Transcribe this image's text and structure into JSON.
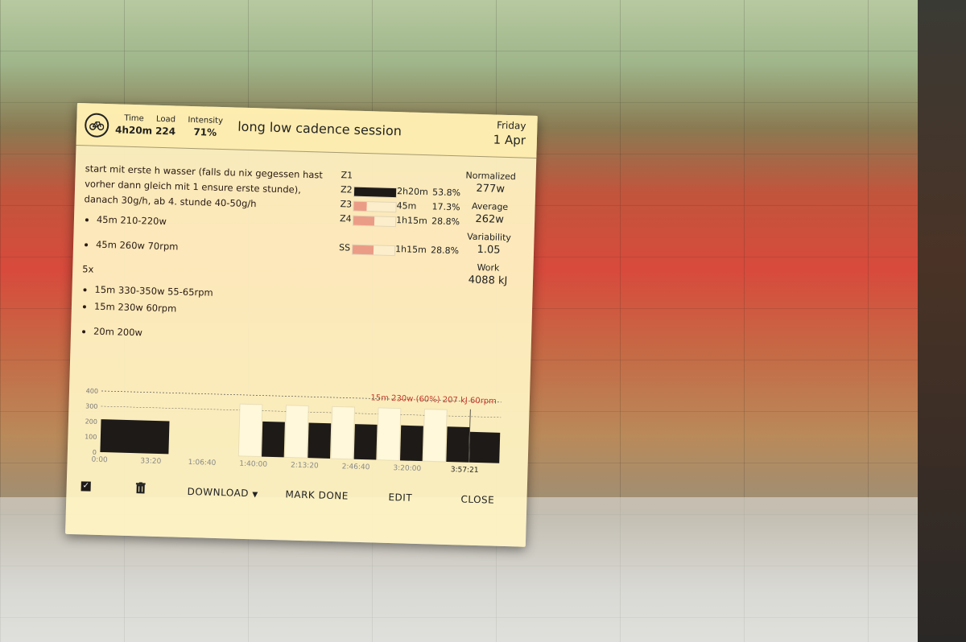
{
  "header": {
    "stats": [
      {
        "label": "Time",
        "value": "4h20m"
      },
      {
        "label": "Load",
        "value": "224"
      },
      {
        "label": "Intensity",
        "value": "71%"
      }
    ],
    "title": "long low cadence session",
    "day": "Friday",
    "date": "1 Apr"
  },
  "description": {
    "intro": "start mit erste h wasser (falls du nix gegessen hast vorher dann gleich mit 1 ensure erste stunde), danach 30g/h, ab 4. stunde 40-50g/h",
    "block1": [
      "45m 210-220w",
      "45m 260w 70rpm"
    ],
    "repeat": "5x",
    "block2": [
      "15m 330-350w 55-65rpm",
      "15m 230w 60rpm"
    ],
    "block3": [
      "20m 200w"
    ]
  },
  "zones": [
    {
      "label": "Z1",
      "time": "",
      "pct": "",
      "fill": 0
    },
    {
      "label": "Z2",
      "time": "2h20m",
      "pct": "53.8%",
      "fill": 1.0
    },
    {
      "label": "Z3",
      "time": "45m",
      "pct": "17.3%",
      "fill": 0.3
    },
    {
      "label": "Z4",
      "time": "1h15m",
      "pct": "28.8%",
      "fill": 0.5
    },
    {
      "label": "",
      "time": "",
      "pct": "",
      "fill": 0
    },
    {
      "label": "SS",
      "time": "1h15m",
      "pct": "28.8%",
      "fill": 0.5
    }
  ],
  "metrics": [
    {
      "label": "Normalized",
      "value": "277w"
    },
    {
      "label": "Average",
      "value": "262w"
    },
    {
      "label": "Variability",
      "value": "1.05"
    },
    {
      "label": "Work",
      "value": "4088 kJ"
    }
  ],
  "chart_data": {
    "type": "bar",
    "tooltip": "15m 230w (60%) 207 kJ 60rpm",
    "y_ticks": [
      "400",
      "300",
      "200",
      "100",
      "0"
    ],
    "x_ticks": [
      "0:00",
      "33:20",
      "1:06:40",
      "1:40:00",
      "2:13:20",
      "2:46:40",
      "3:20:00",
      "3:57:21"
    ],
    "ylim": [
      0,
      400
    ],
    "xlim_min": [
      0,
      260
    ],
    "segments": [
      {
        "start": 0,
        "dur": 45,
        "watts": 215,
        "tone": "dark"
      },
      {
        "start": 45,
        "dur": 45,
        "watts": 0,
        "tone": "none"
      },
      {
        "start": 90,
        "dur": 15,
        "watts": 340,
        "tone": "light"
      },
      {
        "start": 105,
        "dur": 15,
        "watts": 230,
        "tone": "dark"
      },
      {
        "start": 120,
        "dur": 15,
        "watts": 340,
        "tone": "light"
      },
      {
        "start": 135,
        "dur": 15,
        "watts": 230,
        "tone": "dark"
      },
      {
        "start": 150,
        "dur": 15,
        "watts": 340,
        "tone": "light"
      },
      {
        "start": 165,
        "dur": 15,
        "watts": 230,
        "tone": "dark"
      },
      {
        "start": 180,
        "dur": 15,
        "watts": 340,
        "tone": "light"
      },
      {
        "start": 195,
        "dur": 15,
        "watts": 230,
        "tone": "dark"
      },
      {
        "start": 210,
        "dur": 15,
        "watts": 340,
        "tone": "light"
      },
      {
        "start": 225,
        "dur": 15,
        "watts": 230,
        "tone": "dark"
      },
      {
        "start": 240,
        "dur": 20,
        "watts": 200,
        "tone": "dark"
      }
    ]
  },
  "footer": {
    "download": "DOWNLOAD",
    "mark_done": "MARK DONE",
    "edit": "EDIT",
    "close": "CLOSE"
  },
  "colors": {
    "dialog_bg": "#fff4c4",
    "bar_dark": "#1e1a18",
    "bar_light": "#fff8da",
    "accent_red": "#c0392b"
  }
}
